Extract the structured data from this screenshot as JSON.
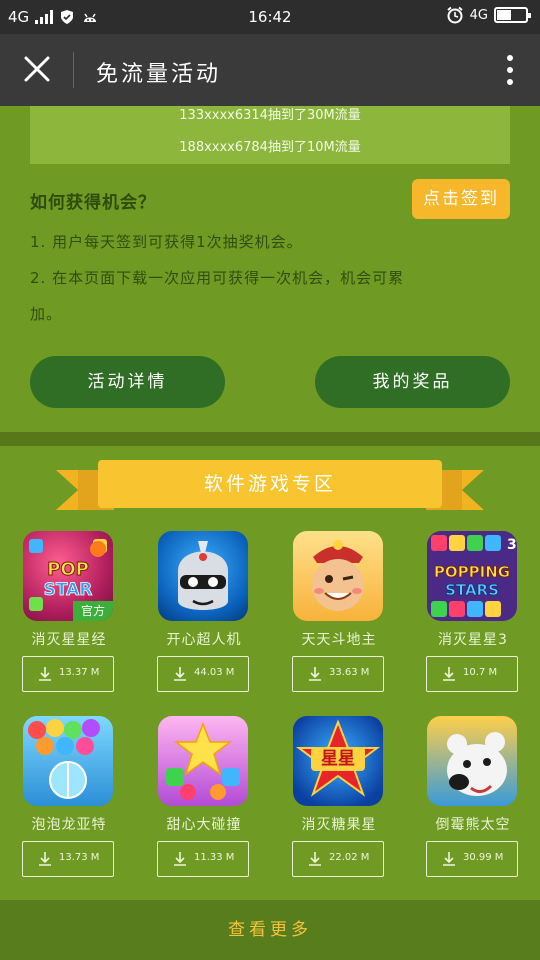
{
  "status_bar": {
    "network_left": "4G",
    "time": "16:42",
    "network_right": "4G"
  },
  "nav": {
    "title": "免流量活动"
  },
  "winners": [
    "133xxxx6314抽到了30M流量",
    "188xxxx6784抽到了10M流量"
  ],
  "how": {
    "title": "如何获得机会？",
    "signin_label": "点击签到",
    "rules": [
      "1.  用户每天签到可获得1次抽奖机会。",
      "2.  在本页面下载一次应用可获得一次机会，机会可累",
      "加。"
    ]
  },
  "buttons": {
    "details": "活动详情",
    "prizes": "我的奖品"
  },
  "section": {
    "title": "软件游戏专区"
  },
  "apps": [
    {
      "name": "消灭星星经",
      "size": "13.37  M",
      "icon": "popstar-icon",
      "badge": "官方"
    },
    {
      "name": "开心超人机",
      "size": "44.03  M",
      "icon": "superman-icon"
    },
    {
      "name": "天天斗地主",
      "size": "33.63  M",
      "icon": "landlord-icon"
    },
    {
      "name": "消灭星星3",
      "size": "10.7  M",
      "icon": "popping-stars-icon"
    },
    {
      "name": "泡泡龙亚特",
      "size": "13.73  M",
      "icon": "bubble-icon"
    },
    {
      "name": "甜心大碰撞",
      "size": "11.33  M",
      "icon": "candy-icon"
    },
    {
      "name": "消灭糖果星",
      "size": "22.02  M",
      "icon": "xingxing-icon",
      "badge": "星星"
    },
    {
      "name": "倒霉熊太空",
      "size": "30.99  M",
      "icon": "bear-icon"
    }
  ],
  "footer": {
    "more_label": "查看更多"
  },
  "colors": {
    "background": "#6f9a24",
    "accent_yellow": "#f8c42f",
    "button_green": "#2f6e24"
  }
}
